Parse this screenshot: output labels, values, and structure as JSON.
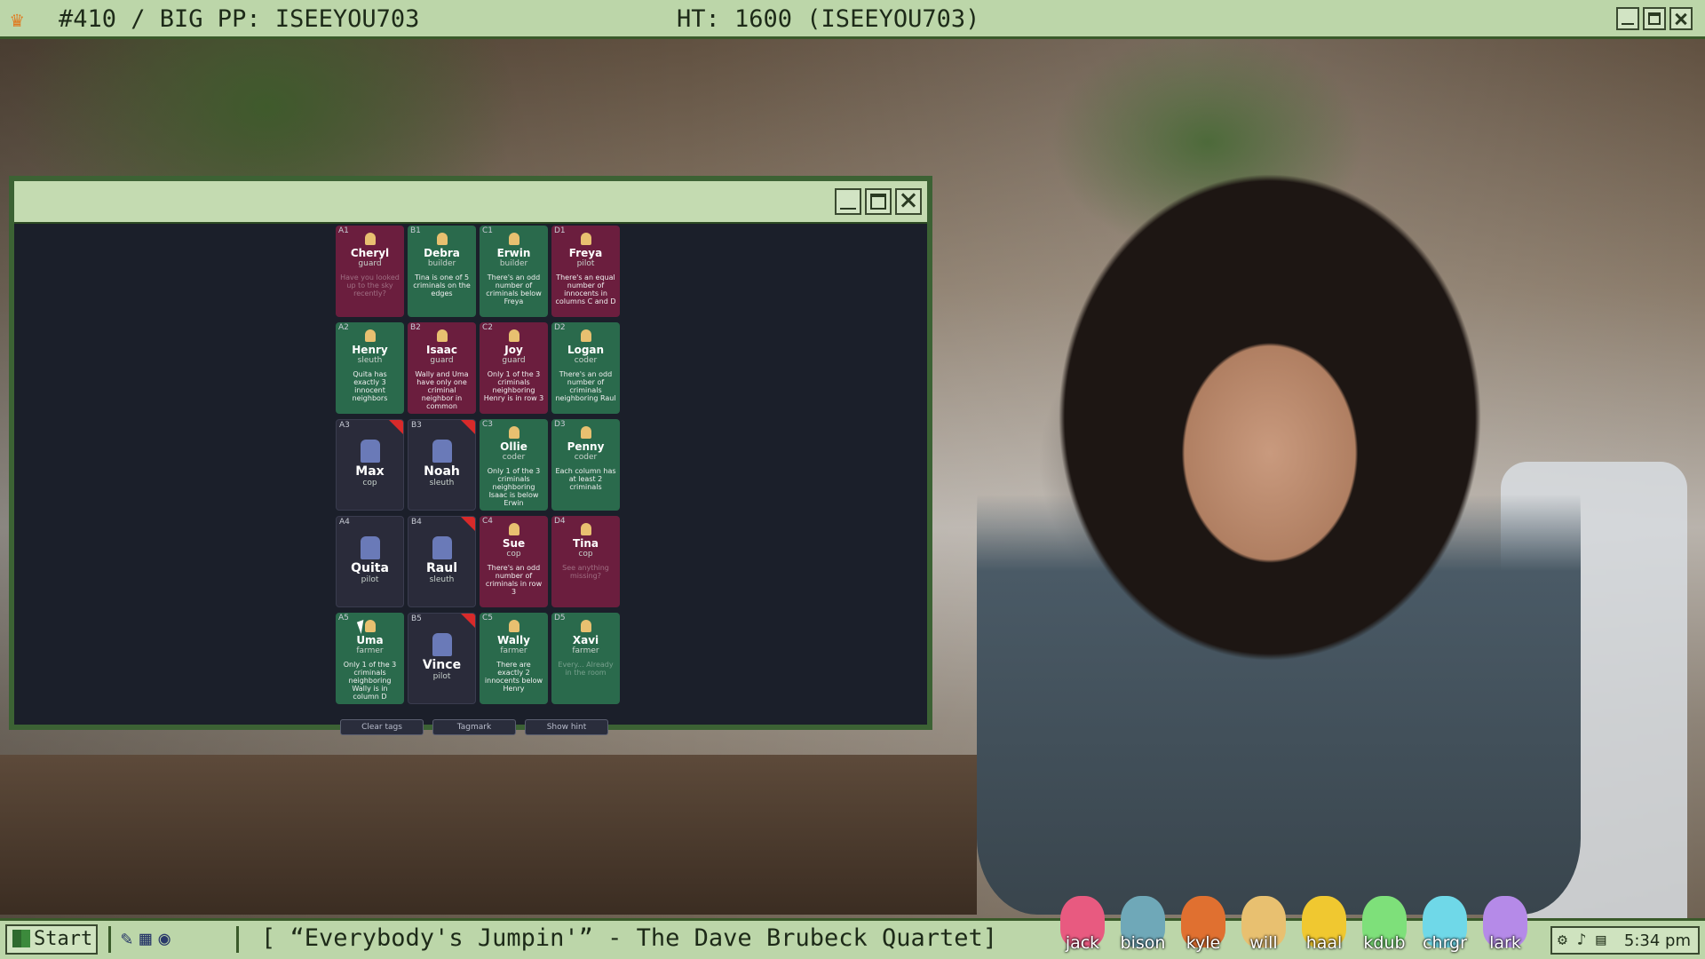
{
  "overlay": {
    "title_left": "#410 / BIG PP: ISEEYOU703",
    "title_center": "HT: 1600 (ISEEYOU703)"
  },
  "game": {
    "cards": [
      {
        "coord": "A1",
        "name": "Cheryl",
        "role": "guard",
        "hint": "Have you looked up to the sky recently?",
        "type": "criminal",
        "faded": true
      },
      {
        "coord": "B1",
        "name": "Debra",
        "role": "builder",
        "hint": "Tina is one of 5 criminals on the edges",
        "type": "innocent"
      },
      {
        "coord": "C1",
        "name": "Erwin",
        "role": "builder",
        "hint": "There's an odd number of criminals below Freya",
        "type": "innocent"
      },
      {
        "coord": "D1",
        "name": "Freya",
        "role": "pilot",
        "hint": "There's an equal number of innocents in columns C and D",
        "type": "criminal"
      },
      {
        "coord": "A2",
        "name": "Henry",
        "role": "sleuth",
        "hint": "Quita has exactly 3 innocent neighbors",
        "type": "innocent"
      },
      {
        "coord": "B2",
        "name": "Isaac",
        "role": "guard",
        "hint": "Wally and Uma have only one criminal neighbor in common",
        "type": "criminal"
      },
      {
        "coord": "C2",
        "name": "Joy",
        "role": "guard",
        "hint": "Only 1 of the 3 criminals neighboring Henry is in row 3",
        "type": "criminal"
      },
      {
        "coord": "D2",
        "name": "Logan",
        "role": "coder",
        "hint": "There's an odd number of criminals neighboring Raul",
        "type": "innocent"
      },
      {
        "coord": "A3",
        "name": "Max",
        "role": "cop",
        "hint": "",
        "type": "hidden",
        "flag": true
      },
      {
        "coord": "B3",
        "name": "Noah",
        "role": "sleuth",
        "hint": "",
        "type": "hidden",
        "flag": true
      },
      {
        "coord": "C3",
        "name": "Ollie",
        "role": "coder",
        "hint": "Only 1 of the 3 criminals neighboring Isaac is below Erwin",
        "type": "innocent"
      },
      {
        "coord": "D3",
        "name": "Penny",
        "role": "coder",
        "hint": "Each column has at least 2 criminals",
        "type": "innocent"
      },
      {
        "coord": "A4",
        "name": "Quita",
        "role": "pilot",
        "hint": "",
        "type": "hidden"
      },
      {
        "coord": "B4",
        "name": "Raul",
        "role": "sleuth",
        "hint": "",
        "type": "hidden",
        "flag": true
      },
      {
        "coord": "C4",
        "name": "Sue",
        "role": "cop",
        "hint": "There's an odd number of criminals in row 3",
        "type": "criminal"
      },
      {
        "coord": "D4",
        "name": "Tina",
        "role": "cop",
        "hint": "See anything missing?",
        "type": "criminal",
        "faded": true
      },
      {
        "coord": "A5",
        "name": "Uma",
        "role": "farmer",
        "hint": "Only 1 of the 3 criminals neighboring Wally is in column D",
        "type": "innocent"
      },
      {
        "coord": "B5",
        "name": "Vince",
        "role": "pilot",
        "hint": "",
        "type": "hidden",
        "flag": true
      },
      {
        "coord": "C5",
        "name": "Wally",
        "role": "farmer",
        "hint": "There are exactly 2 innocents below Henry",
        "type": "innocent"
      },
      {
        "coord": "D5",
        "name": "Xavi",
        "role": "farmer",
        "hint": "Every... Already in the room",
        "type": "innocent",
        "faded": true
      }
    ],
    "buttons": [
      "Clear tags",
      "Tagmark",
      "Show hint"
    ]
  },
  "taskbar": {
    "start_label": "Start",
    "now_playing": "[ “Everybody's Jumpin'” - The Dave Brubeck Quartet]",
    "bunnies": [
      {
        "label": "jack",
        "color": "#e85a80"
      },
      {
        "label": "bison",
        "color": "#6fa8b8"
      },
      {
        "label": "kyle",
        "color": "#e07030"
      },
      {
        "label": "will",
        "color": "#e8c070"
      },
      {
        "label": "haal",
        "color": "#f0c830"
      },
      {
        "label": "kdub",
        "color": "#7ee07a"
      },
      {
        "label": "chrgr",
        "color": "#6fd8e8"
      },
      {
        "label": "lark",
        "color": "#b58ae8"
      }
    ],
    "time": "5:34 pm"
  }
}
